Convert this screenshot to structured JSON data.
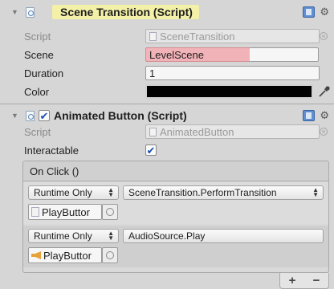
{
  "scene_transition": {
    "title": "Scene Transition (Script)",
    "script_label": "Script",
    "script_value": "SceneTransition",
    "scene_label": "Scene",
    "scene_value": "LevelScene",
    "duration_label": "Duration",
    "duration_value": "1",
    "color_label": "Color",
    "color_value": "#000000"
  },
  "animated_button": {
    "title": "Animated Button (Script)",
    "enabled": true,
    "script_label": "Script",
    "script_value": "AnimatedButton",
    "interactable_label": "Interactable",
    "interactable_checked": true,
    "on_click": {
      "header": "On Click ()",
      "listeners": [
        {
          "runtime": "Runtime Only",
          "function": "SceneTransition.PerformTransition",
          "target": "PlayButtor",
          "target_icon": "script-icon"
        },
        {
          "runtime": "Runtime Only",
          "function": "AudioSource.Play",
          "target": "PlayButtor",
          "target_icon": "audio-source-icon"
        }
      ]
    },
    "add_label": "+",
    "remove_label": "−"
  },
  "check_glyph": "✔",
  "gear_glyph": "⚙",
  "colors": {
    "highlight": "#f3f0a8",
    "missing_field": "#f2b3b8",
    "checkbox_tick": "#1c4fb4"
  }
}
